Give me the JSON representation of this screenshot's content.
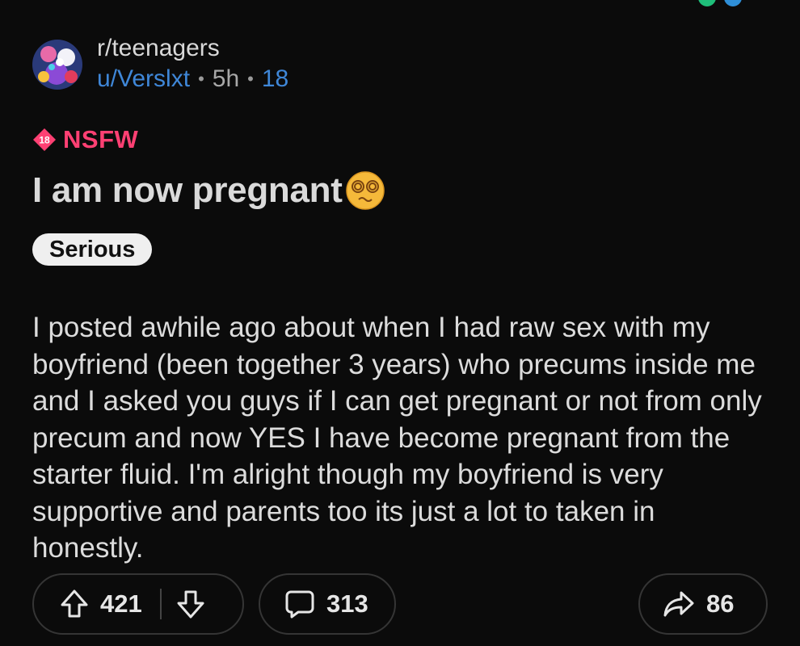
{
  "post": {
    "community": "r/teenagers",
    "username": "u/Verslxt",
    "time": "5h",
    "separator": "•",
    "count": "18",
    "nsfw_badge": "18",
    "nsfw_label": "NSFW",
    "title": "I am now pregnant",
    "title_emoji": "face-with-spiral-eyes",
    "flair": "Serious",
    "body": "I posted awhile ago about when I had raw sex with my boyfriend (been together 3 years) who precums inside me and I asked you guys if I can get pregnant or not from only precum and now YES I have become pregnant from the starter fluid. I'm alright though my boyfriend is very supportive and parents too its just a lot to taken in honestly."
  },
  "actions": {
    "upvotes": "421",
    "comments": "313",
    "shares": "86"
  },
  "colors": {
    "background": "#0b0b0b",
    "link_blue": "#3f87d8",
    "nsfw_pink": "#ff4073",
    "pill_border": "#353535"
  },
  "icons": [
    "upvote-arrow-icon",
    "downvote-arrow-icon",
    "comment-bubble-icon",
    "share-arrow-icon"
  ]
}
